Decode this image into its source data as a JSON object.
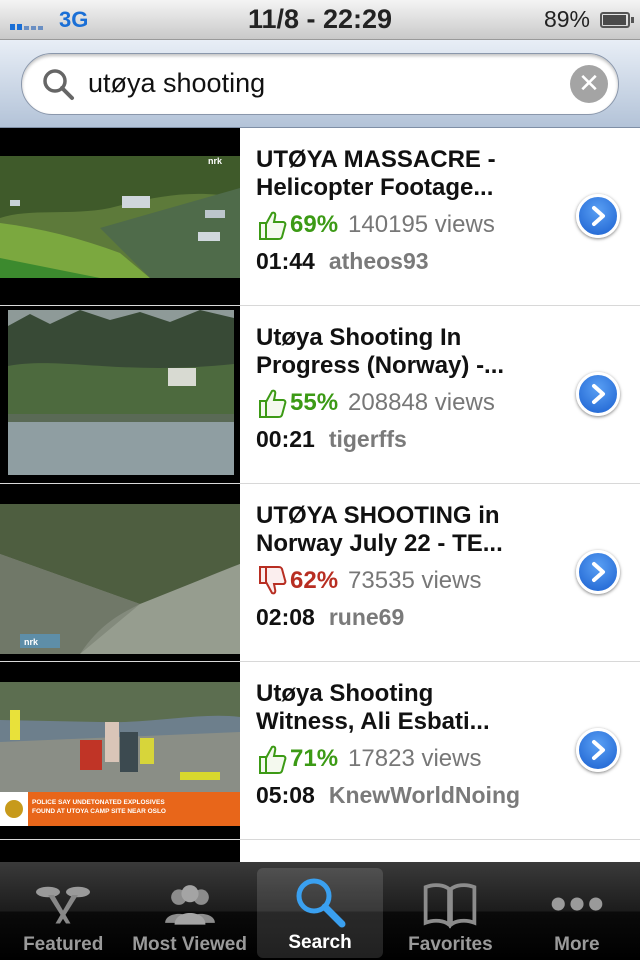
{
  "status_bar": {
    "network": "3G",
    "datetime": "11/8 - 22:29",
    "battery_percent": "89%",
    "battery_level": 0.89
  },
  "search": {
    "query": "utøya shooting",
    "icon": "search-icon",
    "clear_icon": "clear-icon"
  },
  "results": [
    {
      "title_line1": "UTØYA MASSACRE -",
      "title_line2": "Helicopter Footage...",
      "rating": "69%",
      "rating_trend": "up",
      "views": "140195 views",
      "duration": "01:44",
      "author": "atheos93"
    },
    {
      "title_line1": "Utøya Shooting In",
      "title_line2": "Progress (Norway) -...",
      "rating": "55%",
      "rating_trend": "up",
      "views": "208848 views",
      "duration": "00:21",
      "author": "tigerffs"
    },
    {
      "title_line1": "UTØYA SHOOTING in",
      "title_line2": "Norway July 22 - TE...",
      "rating": "62%",
      "rating_trend": "down",
      "views": "73535 views",
      "duration": "02:08",
      "author": "rune69"
    },
    {
      "title_line1": "Utøya Shooting",
      "title_line2": "Witness, Ali Esbati...",
      "rating": "71%",
      "rating_trend": "up",
      "views": "17823 views",
      "duration": "05:08",
      "author": "KnewWorldNoing",
      "thumb_caption_line1": "POLICE SAY UNDETONATED EXPLOSIVES",
      "thumb_caption_line2": "FOUND AT UTOYA CAMP SITE NEAR OSLO"
    }
  ],
  "tabs": [
    {
      "label": "Featured",
      "icon": "featured-icon",
      "active": false
    },
    {
      "label": "Most Viewed",
      "icon": "most-viewed-icon",
      "active": false
    },
    {
      "label": "Search",
      "icon": "search-icon",
      "active": true
    },
    {
      "label": "Favorites",
      "icon": "favorites-icon",
      "active": false
    },
    {
      "label": "More",
      "icon": "more-icon",
      "active": false
    }
  ],
  "colors": {
    "rating_up": "#3c9a15",
    "rating_down": "#b82e22",
    "accent": "#1a5fcf"
  }
}
